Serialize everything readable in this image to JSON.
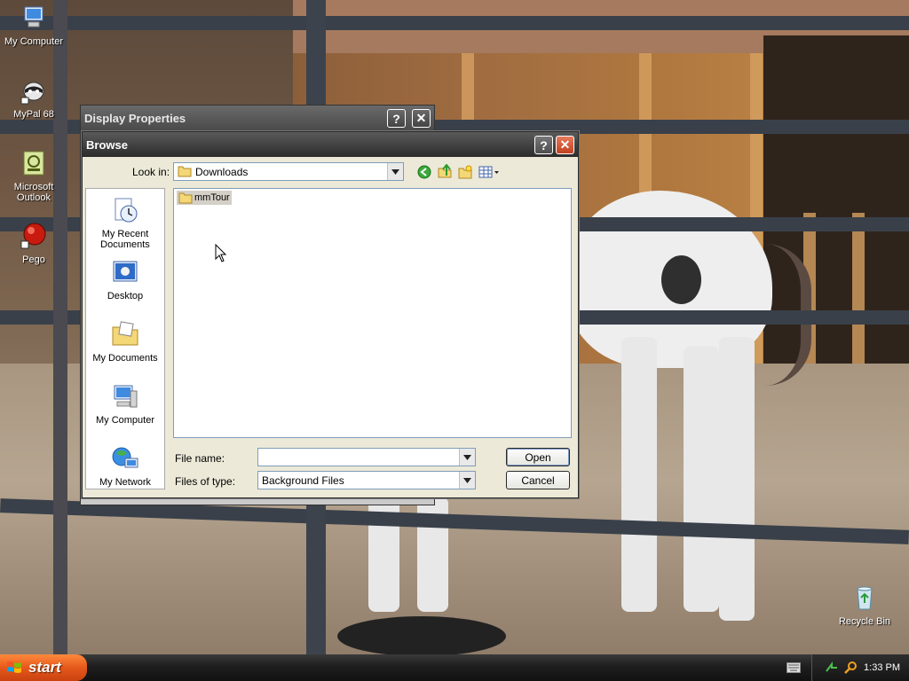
{
  "desktop": {
    "icons": [
      {
        "label": "My Computer",
        "icon": "my-computer-icon"
      },
      {
        "label": "MyPal 68",
        "icon": "raccoon-icon"
      },
      {
        "label": "Microsoft Outlook",
        "icon": "outlook-icon"
      },
      {
        "label": "Pego",
        "icon": "pego-icon"
      },
      {
        "label": "Recycle Bin",
        "icon": "recycle-bin-icon"
      }
    ]
  },
  "display_properties": {
    "title": "Display Properties",
    "help_label": "?",
    "close_label": "✕"
  },
  "browse": {
    "title": "Browse",
    "help_label": "?",
    "close_label": "✕",
    "look_in_label": "Look in:",
    "look_in_value": "Downloads",
    "places": [
      {
        "label": "My Recent Documents",
        "icon": "recent-documents-icon"
      },
      {
        "label": "Desktop",
        "icon": "desktop-icon"
      },
      {
        "label": "My Documents",
        "icon": "my-documents-icon"
      },
      {
        "label": "My Computer",
        "icon": "my-computer-icon"
      },
      {
        "label": "My Network",
        "icon": "my-network-icon"
      }
    ],
    "files": [
      {
        "name": "mmTour",
        "icon": "folder-icon",
        "selected": true
      }
    ],
    "file_name_label": "File name:",
    "file_name_value": "",
    "files_of_type_label": "Files of type:",
    "files_of_type_value": "Background Files",
    "open_label": "Open",
    "cancel_label": "Cancel"
  },
  "taskbar": {
    "start_label": "start",
    "clock": "1:33 PM"
  },
  "colors": {
    "start_orange": "#e5581a",
    "close_red": "#c2401f",
    "dialog_bg": "#ece9d8"
  }
}
